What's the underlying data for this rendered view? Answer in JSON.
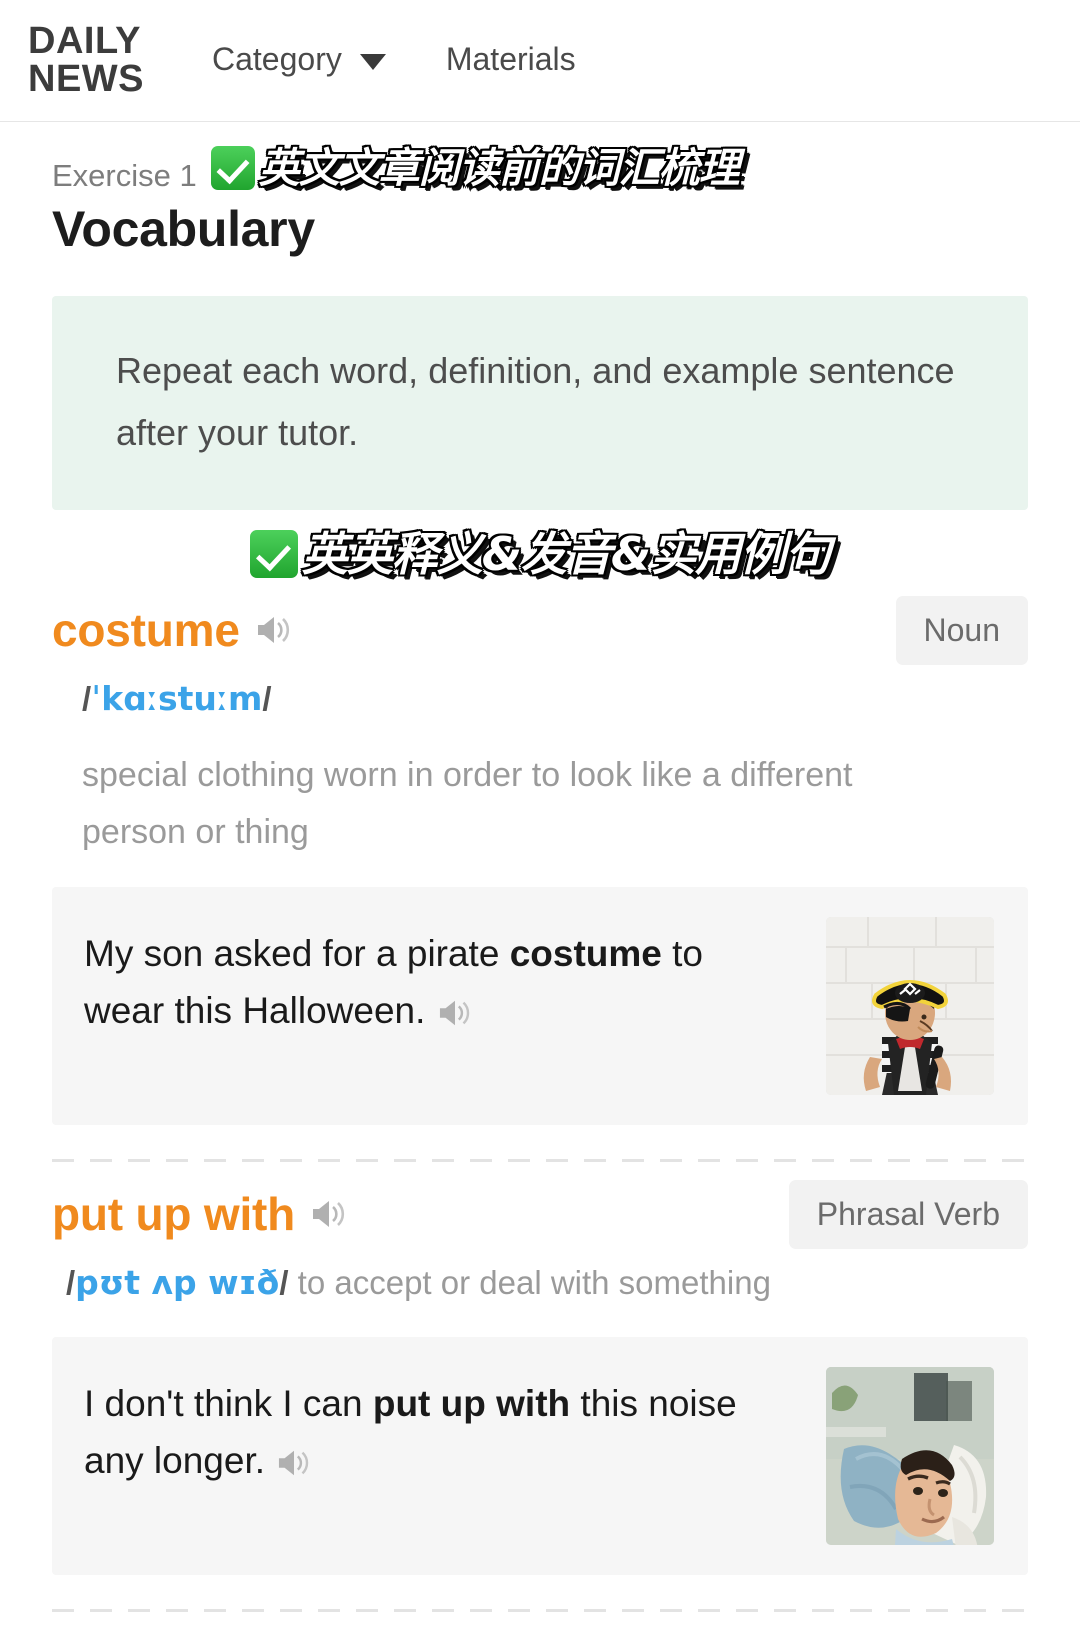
{
  "header": {
    "brand": "DAILY\nNEWS",
    "nav": [
      {
        "label": "Category",
        "has_caret": true,
        "icon": "chevron-down-icon"
      },
      {
        "label": "Materials",
        "has_caret": false
      }
    ]
  },
  "lesson": {
    "exercise_label": "Exercise 1",
    "title": "Vocabulary",
    "cn_overlay_top": "英文文章阅读前的词汇梳理",
    "cn_overlay_mid": "英英释义&发音&实用例句",
    "instruction": "Repeat each word, definition, and example sentence after your tutor."
  },
  "colors": {
    "word_orange": "#f08a1e",
    "ipa_blue": "#3ba3e8",
    "instruction_bg": "#e9f4ee",
    "example_bg": "#f6f6f6",
    "badge_bg": "#f2f2f2",
    "check_green": "#21a52f"
  },
  "entries": [
    {
      "word": "costume",
      "pos": "Noun",
      "ipa": "ˈkɑːstuːm",
      "definition": "special clothing worn in order to look like a different person or thing",
      "inline_definition": "",
      "example_pre": "My son asked for a pirate ",
      "example_bold": "costume",
      "example_post": " to wear this Halloween.",
      "image_alt": "boy-in-pirate-costume-photo",
      "speaker_icon": "speaker-icon"
    },
    {
      "word": "put up with",
      "pos": "Phrasal Verb",
      "ipa": "pʊt ʌp wɪð",
      "definition": "",
      "inline_definition": "to accept or deal with something",
      "example_pre": "I don't think I can ",
      "example_bold": "put up with",
      "example_post": " this noise any longer.",
      "image_alt": "woman-covering-ears-with-pillows-photo",
      "speaker_icon": "speaker-icon"
    }
  ]
}
